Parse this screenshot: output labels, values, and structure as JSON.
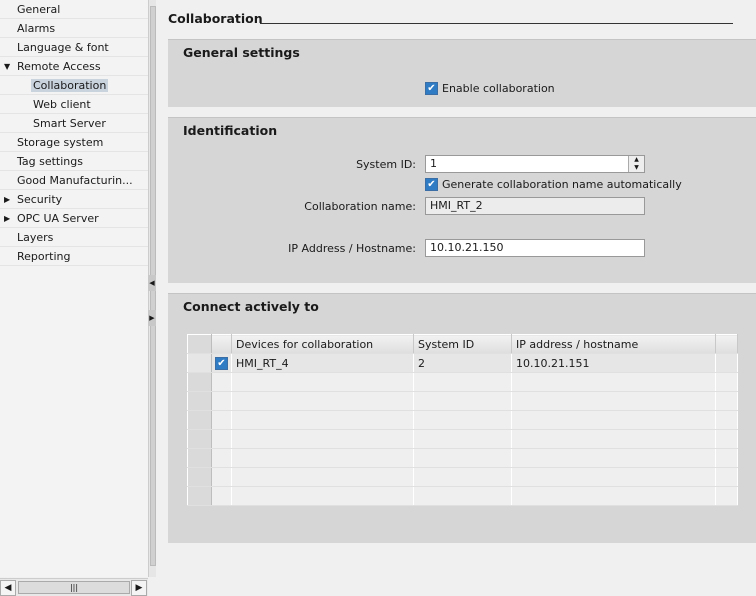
{
  "nav": {
    "items": [
      {
        "label": "General",
        "level": 0
      },
      {
        "label": "Alarms",
        "level": 0
      },
      {
        "label": "Language & font",
        "level": 0
      },
      {
        "label": "Remote Access",
        "level": 0,
        "arrow": "▼"
      },
      {
        "label": "Collaboration",
        "level": 1,
        "selected": true
      },
      {
        "label": "Web client",
        "level": 1
      },
      {
        "label": "Smart Server",
        "level": 1
      },
      {
        "label": "Storage system",
        "level": 0
      },
      {
        "label": "Tag settings",
        "level": 0
      },
      {
        "label": "Good Manufacturin...",
        "level": 0
      },
      {
        "label": "Security",
        "level": 0,
        "arrow": "▶"
      },
      {
        "label": "OPC UA Server",
        "level": 0,
        "arrow": "▶"
      },
      {
        "label": "Layers",
        "level": 0
      },
      {
        "label": "Reporting",
        "level": 0
      }
    ]
  },
  "page": {
    "title": "Collaboration"
  },
  "general": {
    "heading": "General settings",
    "enable_label": "Enable collaboration",
    "enable_checked": true
  },
  "identification": {
    "heading": "Identification",
    "system_id_label": "System ID:",
    "system_id": "1",
    "auto_name_label": "Generate collaboration name automatically",
    "auto_name_checked": true,
    "collab_name_label": "Collaboration name:",
    "collab_name": "HMI_RT_2",
    "ip_label": "IP Address / Hostname:",
    "ip": "10.10.21.150"
  },
  "connect": {
    "heading": "Connect actively to",
    "columns": [
      "Devices for collaboration",
      "System ID",
      "IP address / hostname"
    ],
    "rows": [
      {
        "checked": true,
        "device": "HMI_RT_4",
        "system_id": "2",
        "ip": "10.10.21.151"
      }
    ],
    "empty_rows": 7
  },
  "colors": {
    "checkbox": "#2f7bc4",
    "selected": "#c9d3de",
    "section": "#d6d6d6"
  }
}
